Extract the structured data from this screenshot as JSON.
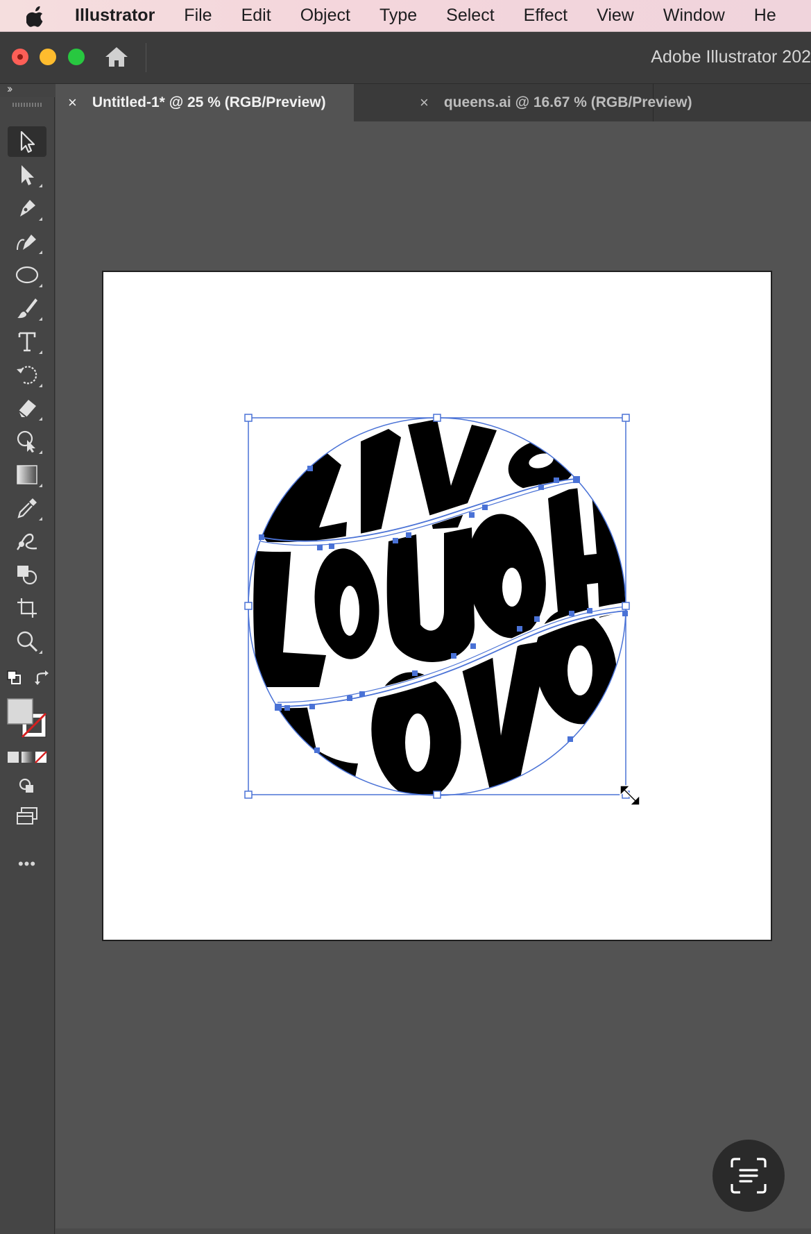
{
  "menubar": {
    "app_name": "Illustrator",
    "items": [
      "File",
      "Edit",
      "Object",
      "Type",
      "Select",
      "Effect",
      "View",
      "Window",
      "He"
    ]
  },
  "titlebar": {
    "title": "Adobe Illustrator 202"
  },
  "tabs": [
    {
      "label": "Untitled-1* @ 25 % (RGB/Preview)",
      "close": "×",
      "active": true
    },
    {
      "label": "queens.ai @ 16.67 % (RGB/Preview)",
      "close": "×",
      "active": false
    }
  ],
  "toolbar": {
    "tools": [
      "selection-tool",
      "direct-selection-tool",
      "pen-tool",
      "curvature-tool",
      "ellipse-tool",
      "paintbrush-tool",
      "type-tool",
      "rotate-tool",
      "eraser-tool",
      "puppet-warp-tool",
      "gradient-tool",
      "eyedropper-tool",
      "blend-tool",
      "shape-builder-tool",
      "artboard-tool",
      "zoom-tool"
    ],
    "more_label": "•••",
    "fill_color": "#d9d9d9",
    "stroke_color": "none"
  },
  "artwork": {
    "words": [
      "LIVe",
      "LaUGH",
      "LOVe"
    ],
    "fill": "#000000",
    "selection_color": "#4a72d6"
  },
  "colors": {
    "menubar_bg": "#f4d8dc",
    "app_bg": "#535353",
    "toolbar_bg": "#454545",
    "tab_active_bg": "#535353",
    "tab_inactive_bg": "#3a3a3a"
  }
}
